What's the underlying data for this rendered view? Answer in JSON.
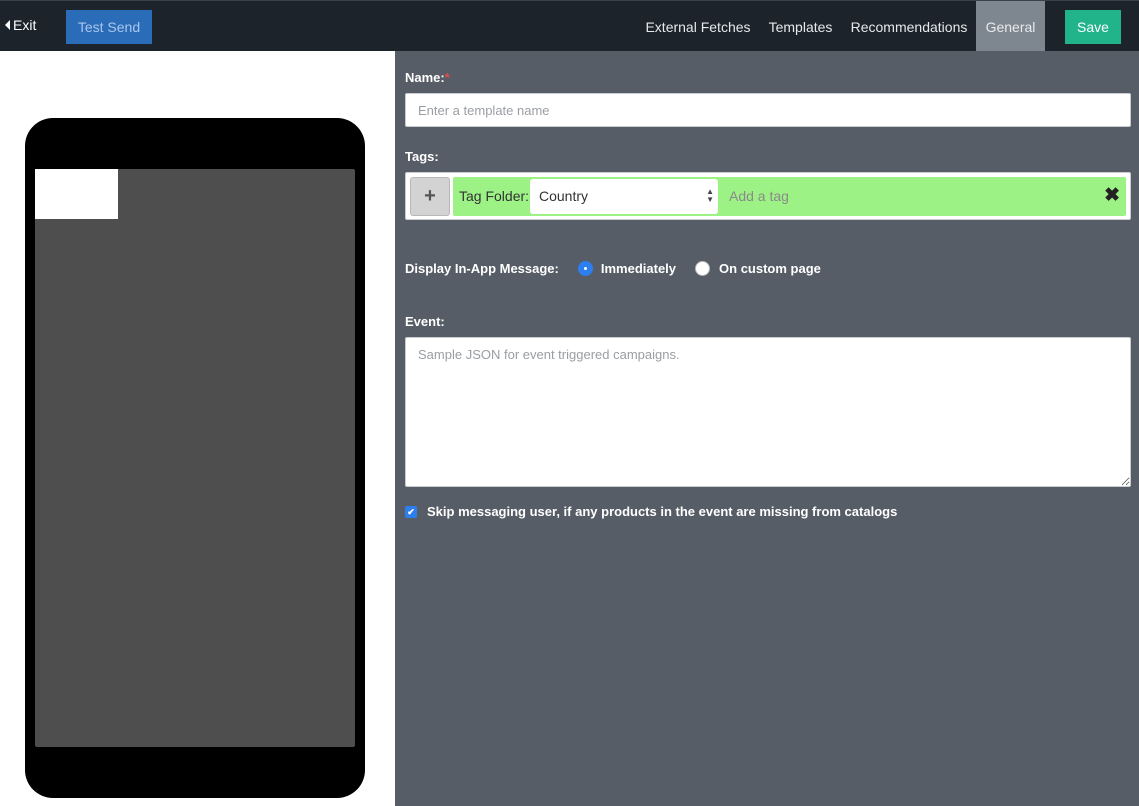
{
  "topbar": {
    "exit_label": "Exit",
    "test_send_label": "Test Send",
    "nav": [
      {
        "label": "External Fetches",
        "active": false
      },
      {
        "label": "Templates",
        "active": false
      },
      {
        "label": "Recommendations",
        "active": false
      },
      {
        "label": "General",
        "active": true
      }
    ],
    "save_label": "Save"
  },
  "form": {
    "name_label": "Name:",
    "name_required_mark": "*",
    "name_placeholder": "Enter a template name",
    "name_value": "",
    "tags_label": "Tags:",
    "tags": {
      "add_button_label": "+",
      "folder_label": "Tag Folder:",
      "folder_selected": "Country",
      "add_tag_placeholder": "Add a tag"
    },
    "display_label": "Display In-App Message:",
    "display_options": [
      {
        "label": "Immediately",
        "selected": true
      },
      {
        "label": "On custom page",
        "selected": false
      }
    ],
    "event_label": "Event:",
    "event_placeholder": "Sample JSON for event triggered campaigns.",
    "skip_label": "Skip messaging user, if any products in the event are missing from catalogs",
    "skip_checked": true
  },
  "colors": {
    "topbar_bg": "#1c232b",
    "form_bg": "#565d66",
    "save_green": "#21b48b",
    "test_send_blue": "#2b6cb8",
    "tag_green": "#9df285",
    "radio_blue": "#2d7ff0"
  }
}
